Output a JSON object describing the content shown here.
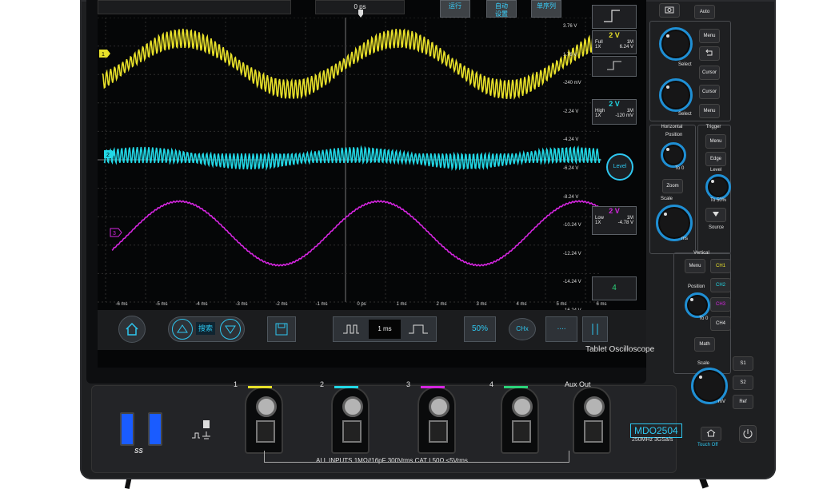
{
  "top": {
    "time_offset": "0 ps",
    "buttons": [
      "运行",
      "自动\n设置",
      "单序列"
    ],
    "trigger_icon": "rising-edge-icon"
  },
  "side": {
    "ch1": {
      "scale": "2 V",
      "bw": "Full",
      "coupling": "1X",
      "imp": "1M",
      "value": "6.24 V"
    },
    "ch2": {
      "scale": "2 V",
      "bw": "High",
      "coupling": "1X",
      "imp": "1M",
      "value": "-120 mV"
    },
    "ch3": {
      "scale": "2 V",
      "bw": "Low",
      "coupling": "1X",
      "imp": "1M",
      "value": "-4.78 V"
    },
    "level_label": "Level",
    "page_num": "4"
  },
  "yaxis": [
    "3.76 V",
    "1.76 V",
    "-240 mV",
    "-2.24 V",
    "-4.24 V",
    "-6.24 V",
    "-8.24 V",
    "-10.24 V",
    "-12.24 V",
    "-14.24 V",
    "-16.24 V"
  ],
  "xaxis": [
    "-6 ms",
    "-5 ms",
    "-4 ms",
    "-3 ms",
    "-2 ms",
    "-1 ms",
    "0 ps",
    "1 ms",
    "2 ms",
    "3 ms",
    "4 ms",
    "5 ms",
    "6 ms"
  ],
  "toolbar": {
    "search_label": "搜索",
    "timebase": "1 ms",
    "fifty": "50%",
    "chx": "CHx",
    "dots": "∙∙∙∙"
  },
  "brand": "Tablet Oscilloscope",
  "front": {
    "channels": [
      "1",
      "2",
      "3",
      "4"
    ],
    "aux": "Aux Out",
    "spec": "ALL INPUTS 1MΩ//16pF 300Vrms CAT I    50Ω  ≤5Vrms",
    "usb_text": "SS",
    "model": "MDO2504",
    "model_sub": "250MHz   3GSa/s"
  },
  "panel": {
    "auto": "Auto",
    "menu": "Menu",
    "select": "Select",
    "cursor": "Cursor",
    "horizontal": "Horizontal",
    "trigger": "Trigger",
    "position": "Position",
    "edge": "Edge",
    "level": "Level",
    "zoom": "Zoom",
    "scale": "Scale",
    "source": "Source",
    "vertical": "Vertical",
    "ch": [
      "CH1",
      "CH2",
      "CH3",
      "CH4"
    ],
    "math": "Math",
    "s1": "S1",
    "s2": "S2",
    "ref": "Ref",
    "to0": "To 0",
    "to50": "To 50%",
    "ms": "ms",
    "mv": "mV",
    "touch_off": "Touch Off"
  },
  "colors": {
    "ch1": "#e8e12a",
    "ch2": "#22d8e6",
    "ch3": "#d526e0",
    "ch4": "#2bd37a",
    "accent": "#2ec7f0"
  }
}
